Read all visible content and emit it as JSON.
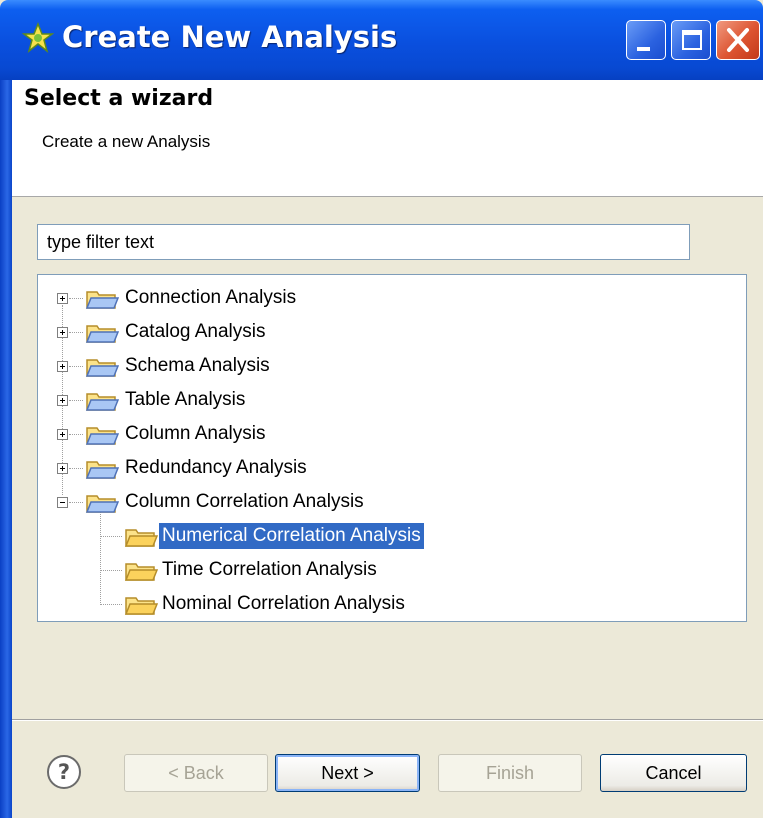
{
  "window": {
    "title": "Create New Analysis",
    "icons": {
      "app": "star-icon",
      "minimize": "minimize-icon",
      "maximize": "maximize-icon",
      "close": "close-icon"
    }
  },
  "header": {
    "title": "Select a wizard",
    "description": "Create a new Analysis"
  },
  "filter": {
    "value": "type filter text"
  },
  "tree": {
    "items": [
      {
        "label": "Connection Analysis",
        "expander": "plus",
        "icon": "folder-icon"
      },
      {
        "label": "Catalog Analysis",
        "expander": "plus",
        "icon": "folder-icon"
      },
      {
        "label": "Schema Analysis",
        "expander": "plus",
        "icon": "folder-icon"
      },
      {
        "label": "Table Analysis",
        "expander": "plus",
        "icon": "folder-icon"
      },
      {
        "label": "Column Analysis",
        "expander": "plus",
        "icon": "folder-icon"
      },
      {
        "label": "Redundancy Analysis",
        "expander": "plus",
        "icon": "folder-icon"
      },
      {
        "label": "Column Correlation Analysis",
        "expander": "minus",
        "icon": "folder-open-icon",
        "children": [
          {
            "label": "Numerical Correlation Analysis",
            "selected": true,
            "icon": "folder-open-icon"
          },
          {
            "label": "Time Correlation Analysis",
            "icon": "folder-open-icon"
          },
          {
            "label": "Nominal Correlation Analysis",
            "icon": "folder-open-icon"
          }
        ]
      }
    ]
  },
  "footer": {
    "help_icon": "help-icon",
    "help_glyph": "?",
    "back_label": "< Back",
    "next_label": "Next >",
    "finish_label": "Finish",
    "cancel_label": "Cancel"
  },
  "colors": {
    "selection": "#316AC5",
    "titlebar": "#0A4FDE",
    "dialog_bg": "#ECE9D8"
  }
}
